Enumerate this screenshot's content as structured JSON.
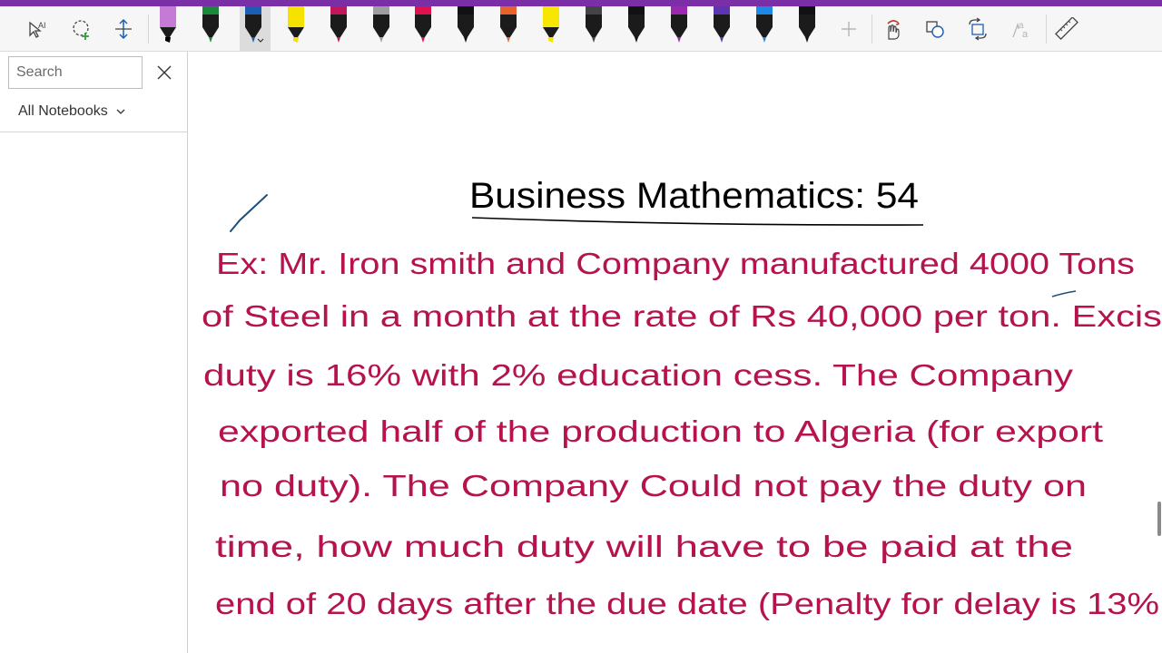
{
  "theme": {
    "accent": "#7b2fa6",
    "ink_title": "#000000",
    "ink_body": "#b5124e",
    "ink_check": "#1f4f7a"
  },
  "toolbar": {
    "tools": [
      {
        "name": "type-to-draw-icon"
      },
      {
        "name": "lasso-select-icon"
      },
      {
        "name": "insert-space-icon"
      }
    ],
    "pens": [
      {
        "color": "#c57ad6",
        "tip": "#000000",
        "kind": "highlighter"
      },
      {
        "color": "#1a8a3a",
        "tip": "#1a8a3a",
        "kind": "pen"
      },
      {
        "color": "#1a5fb4",
        "tip": "#1a5fb4",
        "kind": "pen",
        "selected": true
      },
      {
        "color": "#f5e200",
        "tip": "#f5e200",
        "kind": "highlighter"
      },
      {
        "color": "#c2185b",
        "tip": "#c2185b",
        "kind": "pen"
      },
      {
        "color": "#9e9e9e",
        "tip": "#9e9e9e",
        "kind": "pen"
      },
      {
        "color": "#e0114f",
        "tip": "#e0114f",
        "kind": "pen"
      },
      {
        "color": "#111111",
        "tip": "#111111",
        "kind": "pen"
      },
      {
        "color": "#e8622c",
        "tip": "#e8622c",
        "kind": "pen"
      },
      {
        "color": "#f7e600",
        "tip": "#f7e600",
        "kind": "highlighter"
      },
      {
        "color": "#444444",
        "tip": "#444444",
        "kind": "pen"
      },
      {
        "color": "#111111",
        "tip": "#111111",
        "kind": "pen"
      },
      {
        "color": "#9c27b0",
        "tip": "#9c27b0",
        "kind": "pen"
      },
      {
        "color": "#5e35b1",
        "tip": "#5e35b1",
        "kind": "pen"
      },
      {
        "color": "#1e88e5",
        "tip": "#1e88e5",
        "kind": "pen"
      },
      {
        "color": "#111111",
        "tip": "#111111",
        "kind": "pen"
      }
    ],
    "right_tools": [
      {
        "name": "add-pen-icon"
      },
      {
        "name": "ink-to-shape-icon"
      },
      {
        "name": "shapes-icon"
      },
      {
        "name": "ink-replay-icon"
      },
      {
        "name": "ink-to-math-icon"
      },
      {
        "name": "ruler-icon"
      }
    ]
  },
  "sidebar": {
    "search_placeholder": "Search",
    "search_value": "",
    "notebook_filter": "All Notebooks"
  },
  "page": {
    "title": "Business Mathematics: 54",
    "lines": [
      "Ex:   Mr. Iron smith and Company manufactured 4000 Tons",
      "of Steel in a month at the rate of Rs 40,000 per ton. Excis",
      "duty is 16% with 2% education cess. The Company",
      "exported half of the production to Algeria (for export",
      "no duty). The Company Could not pay the duty on",
      "time, how much duty will have to be paid at the",
      "end of 20 days after the due date (Penalty for delay is 13%"
    ]
  }
}
